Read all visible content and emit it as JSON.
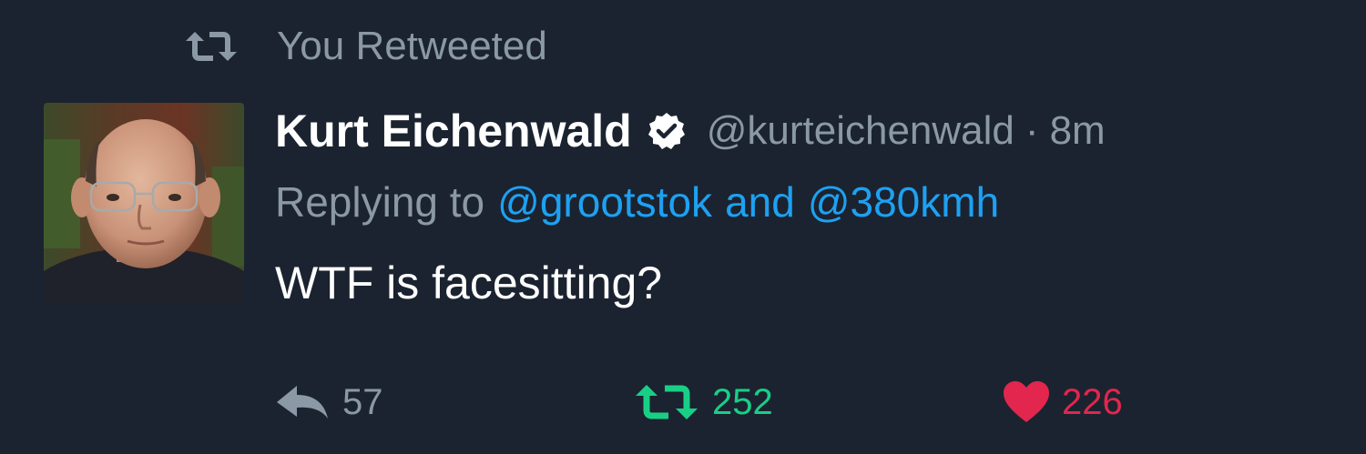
{
  "context": {
    "retweet_label": "You Retweeted"
  },
  "tweet": {
    "display_name": "Kurt Eichenwald",
    "handle": "@kurteichenwald",
    "separator": "·",
    "time": "8m",
    "reply_prefix": "Replying to",
    "reply_mentions": [
      "@grootstok",
      "@380kmh"
    ],
    "reply_joiner": "and",
    "text": "WTF is facesitting?",
    "verified": true
  },
  "actions": {
    "reply_count": "57",
    "retweet_count": "252",
    "like_count": "226"
  },
  "icons": {
    "retweet_context": "retweet-icon",
    "verified": "verified-badge-icon",
    "reply": "reply-icon",
    "retweet": "retweet-icon",
    "like": "heart-icon"
  },
  "colors": {
    "background": "#1b2330",
    "muted": "#8b98a5",
    "link": "#1da1f2",
    "retweet_active": "#19cf86",
    "like_active": "#e2264d"
  }
}
